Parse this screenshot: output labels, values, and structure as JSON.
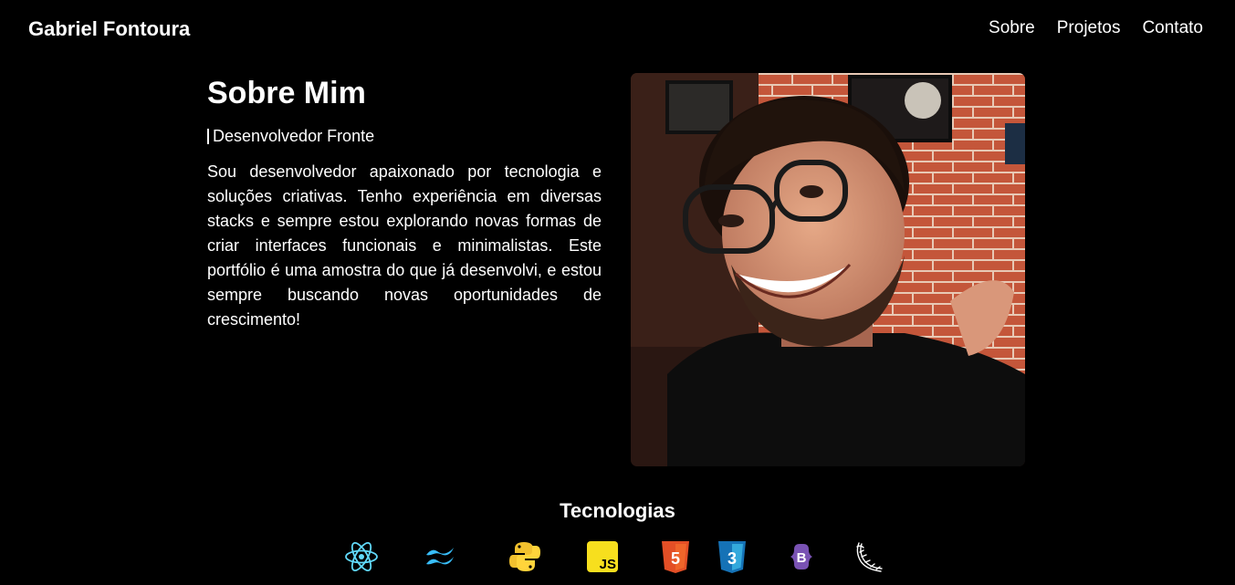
{
  "header": {
    "brand": "Gabriel Fontoura",
    "nav": [
      {
        "label": "Sobre"
      },
      {
        "label": "Projetos"
      },
      {
        "label": "Contato"
      }
    ]
  },
  "about": {
    "title": "Sobre Mim",
    "role": "Desenvolvedor Fronte",
    "bio": "Sou desenvolvedor apaixonado por tecnologia e soluções criativas. Tenho experiência em diversas stacks e sempre estou explorando novas formas de criar interfaces funcionais e minimalistas. Este portfólio é uma amostra do que já desenvolvi, e estou sempre buscando novas oportunidades de crescimento!"
  },
  "technologies": {
    "title": "Tecnologias",
    "icons": [
      {
        "name": "react-icon",
        "color": "#61dafb"
      },
      {
        "name": "tailwind-icon",
        "color": "#38bdf8"
      },
      {
        "name": "python-icon",
        "color": "#ffd43b"
      },
      {
        "name": "javascript-icon",
        "color": "#f7df1e",
        "text": "JS"
      },
      {
        "name": "html5-icon",
        "color": "#e34f26",
        "text": "5"
      },
      {
        "name": "css3-icon",
        "color": "#1572b6",
        "text": "3"
      },
      {
        "name": "bootstrap-icon",
        "color": "#7952b3",
        "text": "B"
      },
      {
        "name": "flask-icon",
        "color": "#ffffff"
      }
    ]
  }
}
